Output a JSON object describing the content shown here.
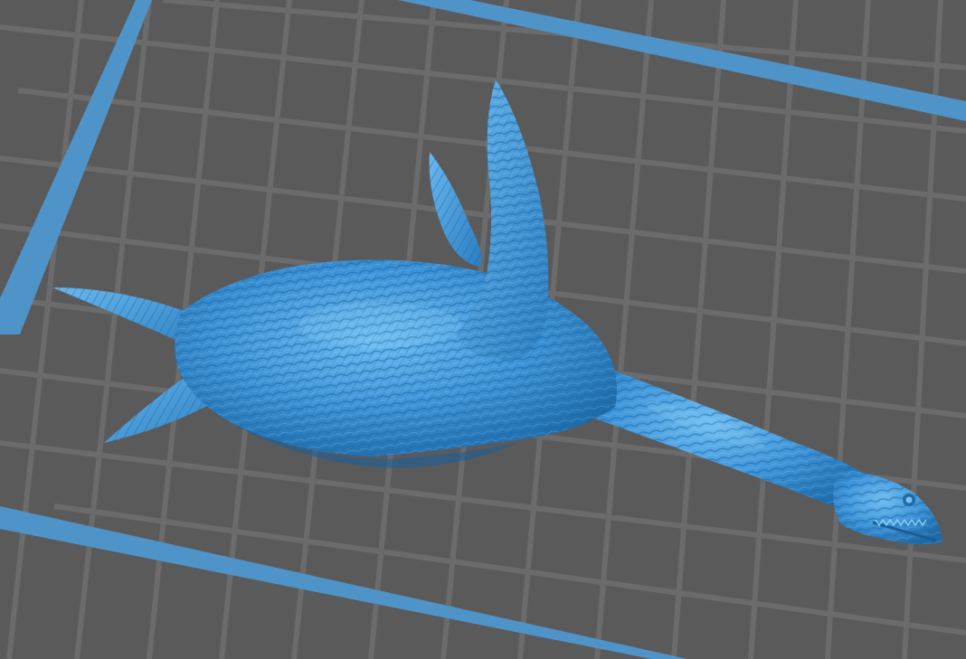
{
  "scene": {
    "background_color": "#5a5a5a",
    "grid_line_color": "#6b6b6b",
    "build_plate_border_color": "#4f94c9",
    "model_color": "#3d94d8",
    "model_shadow_color": "#1f6eae",
    "model_highlight_color": "#7cc3f2",
    "model_name": "plesiosaur-sculpt"
  }
}
